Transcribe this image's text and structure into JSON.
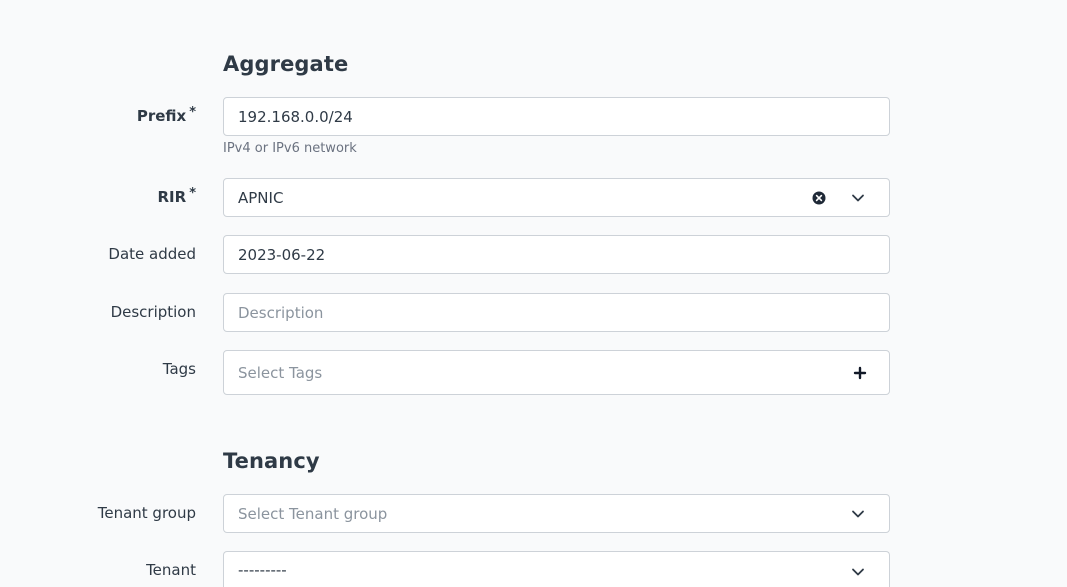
{
  "aggregate": {
    "title": "Aggregate",
    "prefix": {
      "label": "Prefix",
      "required_mark": "*",
      "value": "192.168.0.0/24",
      "help": "IPv4 or IPv6 network"
    },
    "rir": {
      "label": "RIR",
      "required_mark": "*",
      "value": "APNIC"
    },
    "date_added": {
      "label": "Date added",
      "value": "2023-06-22"
    },
    "description": {
      "label": "Description",
      "placeholder": "Description",
      "value": ""
    },
    "tags": {
      "label": "Tags",
      "placeholder": "Select Tags"
    }
  },
  "tenancy": {
    "title": "Tenancy",
    "tenant_group": {
      "label": "Tenant group",
      "placeholder": "Select Tenant group"
    },
    "tenant": {
      "label": "Tenant",
      "value": "---------"
    }
  },
  "icons": {
    "clear": "clear-icon",
    "chevron": "chevron-down-icon",
    "plus": "plus-icon"
  },
  "colors": {
    "background": "#f9fafb",
    "text": "#2f3a46",
    "border": "#cdd2d8",
    "placeholder": "#8b949e"
  }
}
